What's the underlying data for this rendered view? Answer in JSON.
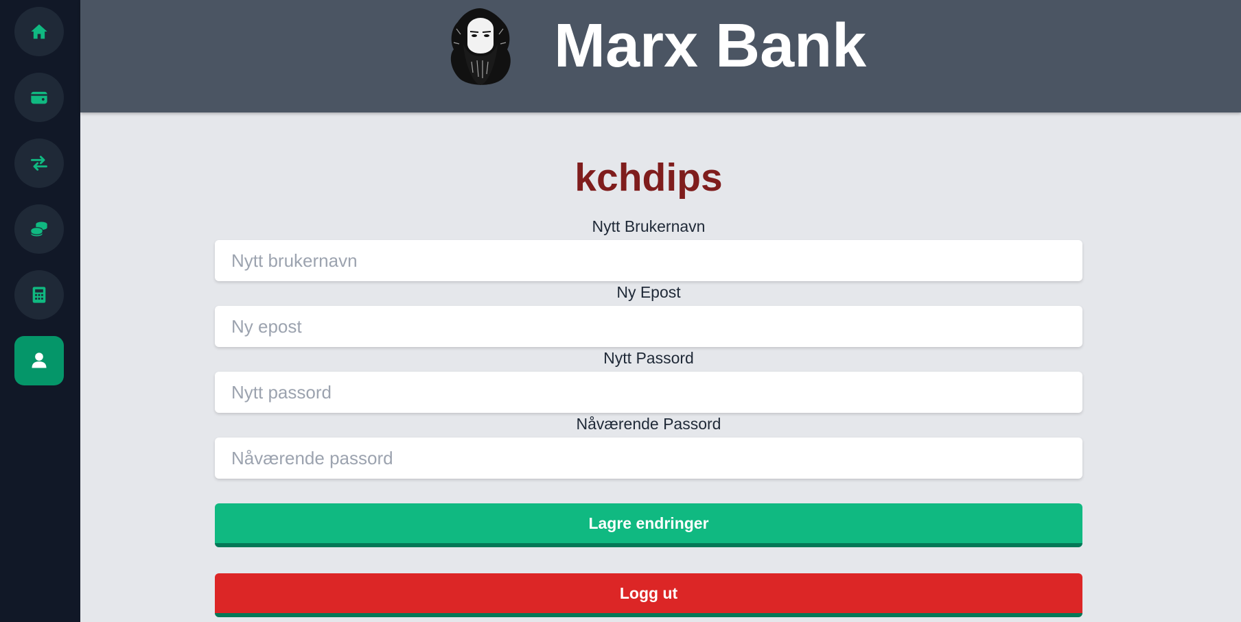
{
  "brand": {
    "title": "Marx Bank",
    "logo_icon": "karl-marx-portrait"
  },
  "sidebar": {
    "accent_color": "#10b981",
    "items": [
      {
        "icon": "home-icon",
        "active": false
      },
      {
        "icon": "wallet-icon",
        "active": false
      },
      {
        "icon": "transfer-icon",
        "active": false
      },
      {
        "icon": "coins-icon",
        "active": false
      },
      {
        "icon": "calculator-icon",
        "active": false
      },
      {
        "icon": "user-icon",
        "active": true
      }
    ]
  },
  "profile": {
    "username": "kchdips",
    "fields": {
      "username": {
        "label": "Nytt Brukernavn",
        "placeholder": "Nytt brukernavn",
        "value": ""
      },
      "email": {
        "label": "Ny Epost",
        "placeholder": "Ny epost",
        "value": ""
      },
      "password": {
        "label": "Nytt Passord",
        "placeholder": "Nytt passord",
        "value": ""
      },
      "current_password": {
        "label": "Nåværende Passord",
        "placeholder": "Nåværende passord",
        "value": ""
      }
    },
    "save_label": "Lagre endringer",
    "logout_label": "Logg ut"
  },
  "colors": {
    "username": "#7f1d1d",
    "save": "#10b981",
    "logout": "#dc2626",
    "header": "#4b5563",
    "sidebar": "#111827"
  }
}
